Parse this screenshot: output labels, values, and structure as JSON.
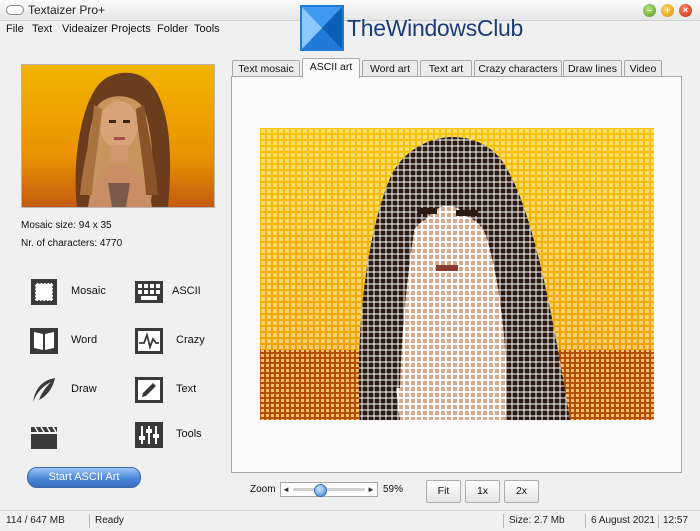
{
  "window": {
    "title": "Textaizer Pro+"
  },
  "menu": {
    "items": [
      "File",
      "Text",
      "Videaizer",
      "Projects",
      "Folder",
      "Tools"
    ]
  },
  "watermark": {
    "text": "TheWindowsClub"
  },
  "info": {
    "mosaic_size": "Mosaic size: 94 x 35",
    "nr_characters": "Nr. of characters: 4770"
  },
  "tools": {
    "mosaic": "Mosaic",
    "ascii": "ASCII",
    "word": "Word",
    "crazy": "Crazy",
    "draw": "Draw",
    "text": "Text",
    "tools": "Tools"
  },
  "start_button": "Start ASCII Art",
  "tabs": [
    {
      "label": "Text mosaic",
      "active": false
    },
    {
      "label": "ASCII art",
      "active": true
    },
    {
      "label": "Word art",
      "active": false
    },
    {
      "label": "Text art",
      "active": false
    },
    {
      "label": "Crazy characters",
      "active": false
    },
    {
      "label": "Draw lines",
      "active": false
    },
    {
      "label": "Video",
      "active": false
    }
  ],
  "zoom": {
    "label": "Zoom",
    "value_text": "59%",
    "slider_value": 0.59
  },
  "buttons": {
    "fit": "Fit",
    "one_x": "1x",
    "two_x": "2x"
  },
  "status": {
    "memory": "114 / 647 MB",
    "state": "Ready",
    "size": "Size: 2.7 Mb",
    "date": "6 August 2021",
    "time": "12:57"
  },
  "colors": {
    "accent": "#4a86d8",
    "art_bg": "#f2b400",
    "art_dark": "#b34f08"
  }
}
